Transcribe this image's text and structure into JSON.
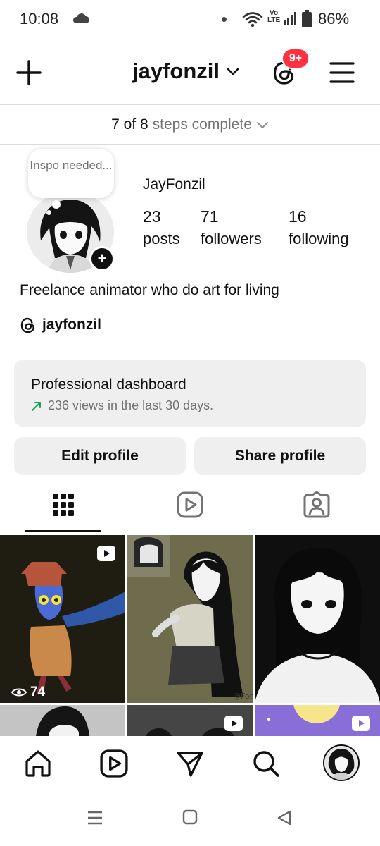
{
  "status_bar": {
    "time": "10:08",
    "volte_top": "Vo",
    "volte_bottom": "LTE",
    "battery": "86%"
  },
  "header": {
    "username": "jayfonzil",
    "notification_badge": "9+",
    "icons": [
      "plus-icon",
      "chevron-down-icon",
      "threads-icon",
      "hamburger-menu-icon"
    ]
  },
  "steps": {
    "count": "7 of 8",
    "label": "steps complete"
  },
  "profile": {
    "note": "Inspo needed...",
    "display_name": "JayFonzil",
    "stats": [
      {
        "value": "23",
        "label": "posts"
      },
      {
        "value": "71",
        "label": "followers"
      },
      {
        "value": "16",
        "label": "following"
      }
    ],
    "bio": "Freelance animator who do art for living",
    "threads_handle": "jayfonzil"
  },
  "dashboard": {
    "title": "Professional dashboard",
    "subtitle": "236 views in the last 30 days."
  },
  "buttons": {
    "edit": "Edit profile",
    "share": "Share profile"
  },
  "tabs": [
    "grid-icon",
    "reels-icon",
    "tagged-icon"
  ],
  "grid": {
    "first_post_views": "74"
  },
  "colors": {
    "badge": "#ff3040",
    "card_bg": "#efefef",
    "trend_arrow": "#1e9e57",
    "muted_text": "#737373"
  }
}
